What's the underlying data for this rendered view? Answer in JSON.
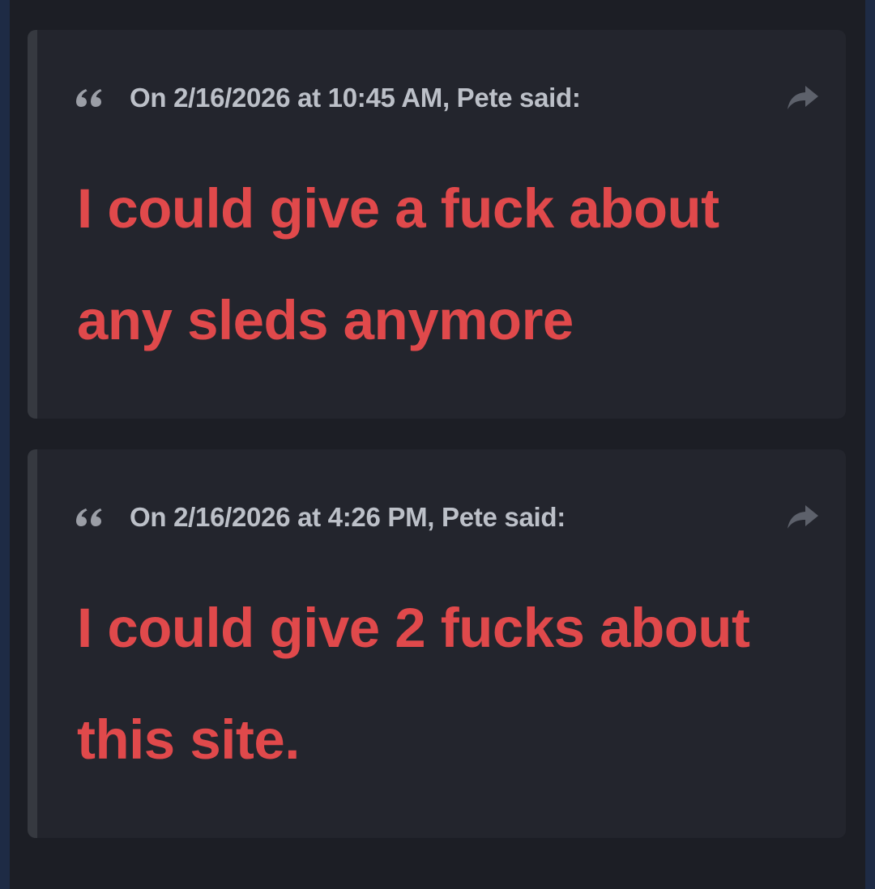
{
  "quotes": [
    {
      "citation": "On 2/16/2026 at 10:45 AM, Pete said:",
      "lines": [
        "I could give a fuck about",
        "any sleds anymore"
      ]
    },
    {
      "citation": "On 2/16/2026 at 4:26 PM, Pete said:",
      "lines": [
        "I could give 2 fucks about",
        "this site."
      ]
    }
  ],
  "icons": {
    "quote": "quote-left-icon",
    "share": "share-arrow-icon"
  },
  "colors": {
    "page_edge": "#1e2b45",
    "post_background": "#1c1e25",
    "quote_background": "#23252d",
    "quote_border": "#363940",
    "citation_text": "#bcc0c8",
    "content_text": "#e0494b",
    "icon": "#9b9ea6",
    "share_icon": "#5d616b"
  }
}
